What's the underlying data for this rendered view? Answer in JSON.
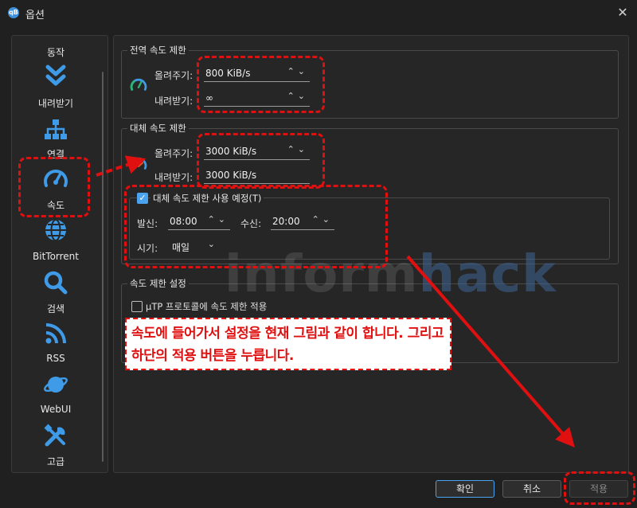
{
  "window": {
    "title": "옵션",
    "app_icon": "qB"
  },
  "sidebar": {
    "items": [
      {
        "label": "동작",
        "icon": "settings-icon"
      },
      {
        "label": "내려받기",
        "icon": "download-icon"
      },
      {
        "label": "연결",
        "icon": "network-icon"
      },
      {
        "label": "속도",
        "icon": "speedometer-icon"
      },
      {
        "label": "BitTorrent",
        "icon": "globe-icon"
      },
      {
        "label": "검색",
        "icon": "search-icon"
      },
      {
        "label": "RSS",
        "icon": "rss-icon"
      },
      {
        "label": "WebUI",
        "icon": "planet-icon"
      },
      {
        "label": "고급",
        "icon": "tools-icon"
      }
    ]
  },
  "global_limits": {
    "title": "전역 속도 제한",
    "upload_label": "올려주기:",
    "upload_value": "800 KiB/s",
    "download_label": "내려받기:",
    "download_value": "∞"
  },
  "alt_limits": {
    "title": "대체 속도 제한",
    "upload_label": "올려주기:",
    "upload_value": "3000 KiB/s",
    "download_label": "내려받기:",
    "download_value": "3000 KiB/s",
    "schedule_checkbox_label": "대체 속도 제한 사용 예정(T)",
    "schedule_checked": true,
    "from_label": "발신:",
    "from_value": "08:00",
    "to_label": "수신:",
    "to_value": "20:00",
    "when_label": "시기:",
    "when_value": "매일"
  },
  "limit_settings": {
    "title": "속도 제한 설정",
    "utp_label": "µTP 프로토콜에 속도 제한 적용",
    "utp_checked": false
  },
  "watermark": {
    "part1": "inform",
    "part2": "hack"
  },
  "annotation_note": "속도에 들어가서 설정을 현재 그림과 같이 합니다. 그리고 하단의 적용 버튼을 누릅니다.",
  "buttons": {
    "ok": "확인",
    "cancel": "취소",
    "apply": "적용"
  },
  "colors": {
    "accent": "#4aa3ee",
    "annotation_red": "#e01010",
    "background": "#202020"
  }
}
